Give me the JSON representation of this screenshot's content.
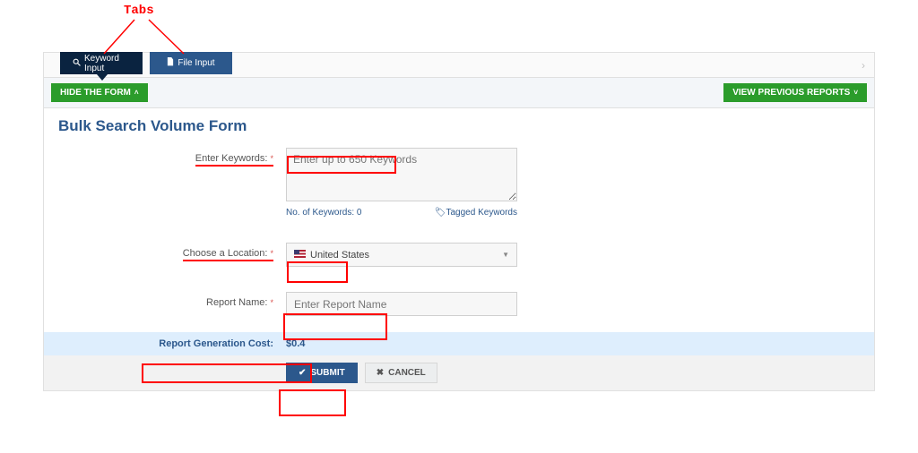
{
  "annotation": {
    "tabs_label": "Tabs"
  },
  "tabs": {
    "keyword_input": "Keyword Input",
    "file_input": "File Input"
  },
  "toolbar": {
    "hide_form": "HIDE THE FORM",
    "view_reports": "VIEW PREVIOUS REPORTS"
  },
  "form": {
    "title": "Bulk Search Volume Form",
    "keywords_label": "Enter Keywords:",
    "keywords_placeholder": "Enter up to 650 Keywords",
    "keywords_count_label": "No. of Keywords: 0",
    "tagged_keywords": "Tagged Keywords",
    "location_label": "Choose a Location:",
    "location_value": "United States",
    "report_name_label": "Report Name:",
    "report_name_placeholder": "Enter Report Name",
    "cost_label": "Report Generation Cost:",
    "cost_value": "$0.4",
    "submit": "SUBMIT",
    "cancel": "CANCEL"
  }
}
